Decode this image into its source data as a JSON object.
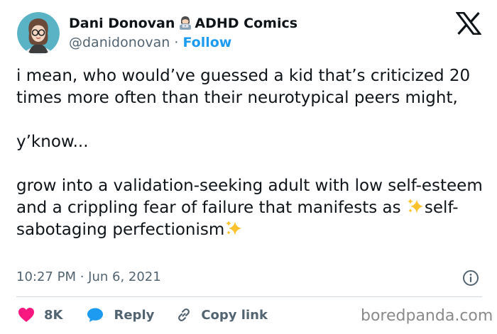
{
  "author": {
    "display_name": "Dani Donovan",
    "name_suffix": "ADHD Comics",
    "handle": "@danidonovan",
    "separator": "·",
    "follow_label": "Follow"
  },
  "tweet": {
    "paragraph_1": "i mean, who would’ve guessed a kid that’s criticized 20 times more often than their neurotypical peers might,",
    "paragraph_2": "y’know...",
    "paragraph_3_before": "grow into a validation-seeking adult with low self-esteem and a crippling fear of failure that manifests as ",
    "paragraph_3_highlight": "self-sabotaging perfectionism",
    "timestamp": "10:27 PM · Jun 6, 2021"
  },
  "actions": {
    "like_count": "8K",
    "reply_label": "Reply",
    "copy_link_label": "Copy link"
  },
  "watermark": "boredpanda.com",
  "icons": {
    "brand": "x-logo-icon",
    "name_emoji": "woman-technologist-emoji",
    "sparkles": "sparkles-emoji",
    "info": "info-icon",
    "like": "heart-icon",
    "reply": "speech-bubble-icon",
    "copy_link": "link-icon"
  },
  "colors": {
    "text": "#0f1419",
    "secondary_text": "#536471",
    "follow_blue": "#1d9bf0",
    "like_pink": "#f91880",
    "divider": "#cfd9de",
    "sparkle_gold": "#f9c22e",
    "watermark_gray": "#8a8a8a"
  }
}
